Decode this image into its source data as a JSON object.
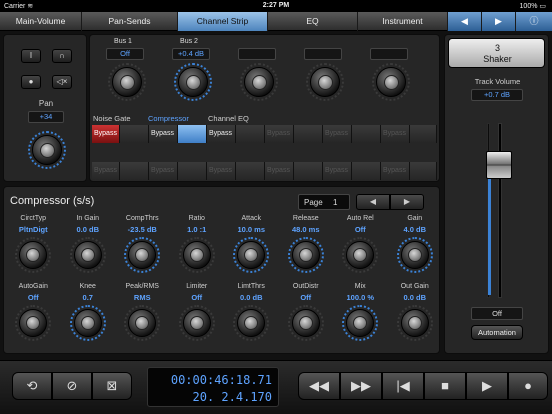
{
  "status": {
    "carrier": "Carrier ≋",
    "time": "2:27 PM",
    "battery": "100% ▭"
  },
  "tabs": [
    {
      "label": "Main-Volume",
      "active": false
    },
    {
      "label": "Pan-Sends",
      "active": false
    },
    {
      "label": "Channel Strip",
      "active": true
    },
    {
      "label": "EQ",
      "active": false
    },
    {
      "label": "Instrument",
      "active": false
    }
  ],
  "nav": {
    "prev": "◀",
    "next": "▶",
    "info": "ⓘ"
  },
  "left_panel": {
    "buttons": [
      {
        "name": "record-arm-button",
        "glyph": "I"
      },
      {
        "name": "monitor-headphones-button",
        "glyph": "∩"
      },
      {
        "name": "record-button",
        "glyph": "●"
      },
      {
        "name": "mute-button",
        "glyph": "◁×"
      }
    ],
    "pan_label": "Pan",
    "pan_value": "+34"
  },
  "buses": [
    {
      "name": "Bus 1",
      "value": "Off"
    },
    {
      "name": "Bus 2",
      "value": "+0.4 dB"
    },
    {
      "name": "",
      "value": ""
    },
    {
      "name": "",
      "value": ""
    },
    {
      "name": "",
      "value": ""
    }
  ],
  "inserts": {
    "headers": [
      "Noise Gate",
      "Compressor",
      "Channel EQ"
    ],
    "row1": [
      "Bypass",
      "",
      "Bypass",
      "",
      "Bypass",
      "",
      "Bypass",
      "",
      "Bypass",
      "",
      "Bypass",
      "",
      "Bypass",
      "",
      "Bypass",
      ""
    ],
    "row2": [
      "Bypass",
      "",
      "Bypass",
      "",
      "Bypass",
      "",
      "Bypass",
      "",
      "Bypass",
      "",
      "Bypass",
      "",
      "Bypass",
      "",
      "Bypass",
      ""
    ]
  },
  "plugin": {
    "title": "Compressor (s/s)",
    "page_label": "Page",
    "page_value": "1",
    "prev": "◀",
    "next": "▶",
    "row1": [
      {
        "label": "CirctTyp",
        "value": "PltnDigt"
      },
      {
        "label": "In Gain",
        "value": "0.0 dB"
      },
      {
        "label": "CompThrs",
        "value": "-23.5 dB"
      },
      {
        "label": "Ratio",
        "value": "1.0 :1"
      },
      {
        "label": "Attack",
        "value": "10.0 ms"
      },
      {
        "label": "Release",
        "value": "48.0 ms"
      },
      {
        "label": "Auto Rel",
        "value": "Off"
      },
      {
        "label": "Gain",
        "value": "4.0 dB"
      }
    ],
    "row2": [
      {
        "label": "AutoGain",
        "value": "Off"
      },
      {
        "label": "Knee",
        "value": "0.7"
      },
      {
        "label": "Peak/RMS",
        "value": "RMS"
      },
      {
        "label": "Limiter",
        "value": "Off"
      },
      {
        "label": "LimtThrs",
        "value": "0.0 dB"
      },
      {
        "label": "OutDistr",
        "value": "Off"
      },
      {
        "label": "Mix",
        "value": "100.0 %"
      },
      {
        "label": "Out Gain",
        "value": "0.0 dB"
      }
    ]
  },
  "track": {
    "instrument_number": "3",
    "instrument_name": "Shaker",
    "volume_label": "Track Volume",
    "volume_value": "+0.7 dB",
    "automation_mode": "Off",
    "automation_label": "Automation"
  },
  "transport": {
    "left_buttons": [
      "⟲",
      "⊘",
      "⊠"
    ],
    "time": "00:00:46:18.71",
    "bars": "20. 2.4.170",
    "controls": [
      "◀◀",
      "▶▶",
      "|◀",
      "■",
      "▶",
      "●"
    ]
  },
  "colors": {
    "accent": "#5ea3ff",
    "active_tab": "#7fb0e0",
    "bypass_red": "#c33333"
  }
}
